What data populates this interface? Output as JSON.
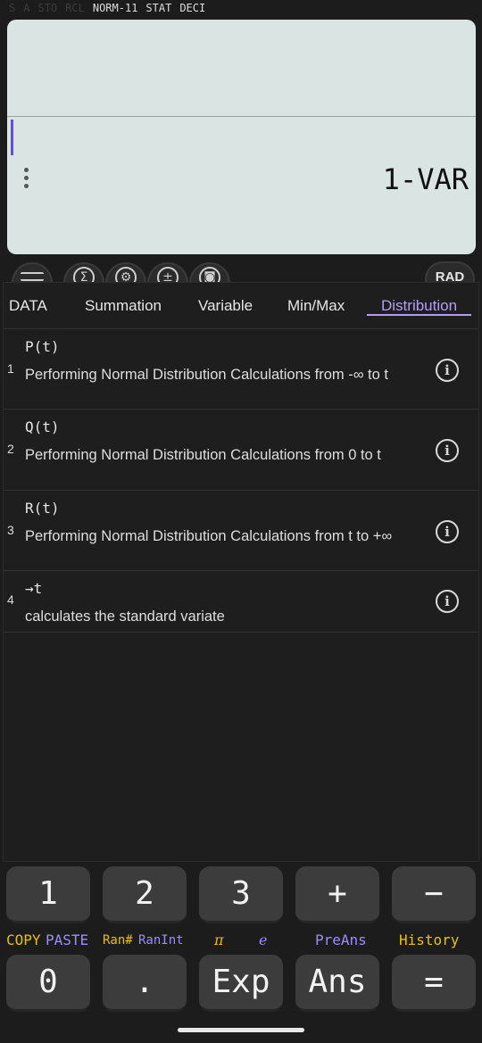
{
  "status": {
    "dim": [
      "S",
      "A",
      "STO",
      "RCL"
    ],
    "active": [
      "NORM-11",
      "STAT",
      "DECI"
    ]
  },
  "display": {
    "result": "1-VAR"
  },
  "toolbar": {
    "buttons": [
      {
        "name": "menu-icon",
        "glyph": ""
      },
      {
        "name": "sigma-icon",
        "glyph": "Σ"
      },
      {
        "name": "settings-icon",
        "glyph": "⚙"
      },
      {
        "name": "plus-minus-icon",
        "glyph": "±"
      },
      {
        "name": "camera-icon",
        "glyph": "◙"
      }
    ],
    "rad_label": "RAD"
  },
  "tabs": [
    "DATA",
    "Summation",
    "Variable",
    "Min/Max",
    "Distribution"
  ],
  "active_tab": "Distribution",
  "items": [
    {
      "num": "1",
      "fn": "P(t)",
      "desc": "Performing Normal Distribution Calculations from -∞ to t"
    },
    {
      "num": "2",
      "fn": "Q(t)",
      "desc": "Performing Normal Distribution Calculations from 0 to t"
    },
    {
      "num": "3",
      "fn": "R(t)",
      "desc": "Performing Normal Distribution Calculations from t to +∞"
    },
    {
      "num": "4",
      "fn": "→t",
      "desc": "calculates the standard variate"
    }
  ],
  "info_glyph": "i",
  "keypad": {
    "row1": [
      "1",
      "2",
      "3",
      "+",
      "−"
    ],
    "sublabels": [
      "COPY",
      "PASTE",
      "Ran#",
      "RanInt",
      "π",
      "e",
      "PreAns",
      "History"
    ],
    "row2": [
      "0",
      ".",
      "Exp",
      "Ans",
      "="
    ]
  }
}
